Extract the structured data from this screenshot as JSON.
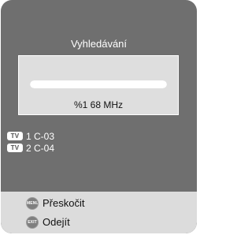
{
  "dialog": {
    "title": "Vyhledávání",
    "progress": {
      "fraction": 1.0,
      "status": "%1 68 MHz"
    },
    "channels": [
      {
        "badge": "TV",
        "label": "1 C-03"
      },
      {
        "badge": "TV",
        "label": "2 C-04"
      }
    ],
    "footer": {
      "skip": {
        "key": "MENU",
        "label": "Přeskočit"
      },
      "exit": {
        "key": "EXIT",
        "label": "Odejít"
      }
    }
  }
}
